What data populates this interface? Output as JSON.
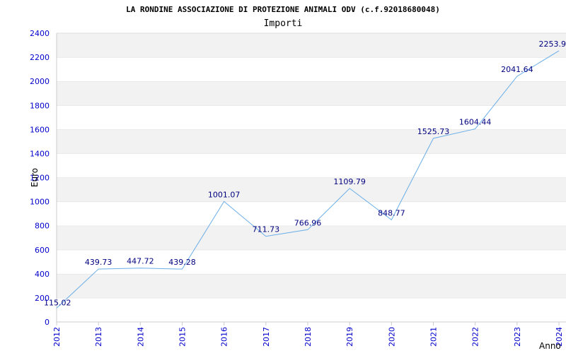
{
  "chart_data": {
    "type": "line",
    "title": "LA RONDINE ASSOCIAZIONE DI PROTEZIONE ANIMALI ODV (c.f.92018680048)",
    "subtitle": "Importi",
    "xlabel": "Anno",
    "ylabel": "Euro",
    "x": [
      "2012",
      "2013",
      "2014",
      "2015",
      "2016",
      "2017",
      "2018",
      "2019",
      "2020",
      "2021",
      "2022",
      "2023",
      "2024"
    ],
    "values": [
      115.02,
      439.73,
      447.72,
      439.28,
      1001.07,
      711.73,
      766.96,
      1109.79,
      848.77,
      1525.73,
      1604.44,
      2041.64,
      2253.9
    ],
    "value_labels": [
      "115.02",
      "439.73",
      "447.72",
      "439.28",
      "1001.07",
      "711.73",
      "766.96",
      "1109.79",
      "848.77",
      "1525.73",
      "1604.44",
      "2041.64",
      "2253.9"
    ],
    "ylim": [
      0,
      2400
    ],
    "yticks": [
      "0",
      "200",
      "400",
      "600",
      "800",
      "1000",
      "1200",
      "1400",
      "1600",
      "1800",
      "2000",
      "2200",
      "2400"
    ],
    "grid": true,
    "legend": "none",
    "colors": {
      "line": "#6aaee8",
      "band": "#f2f2f2",
      "gridline": "#dddddd",
      "tick_text": "#0000cc",
      "data_label": "#000080",
      "title_text": "#000000",
      "axis": "#cccccc"
    }
  }
}
